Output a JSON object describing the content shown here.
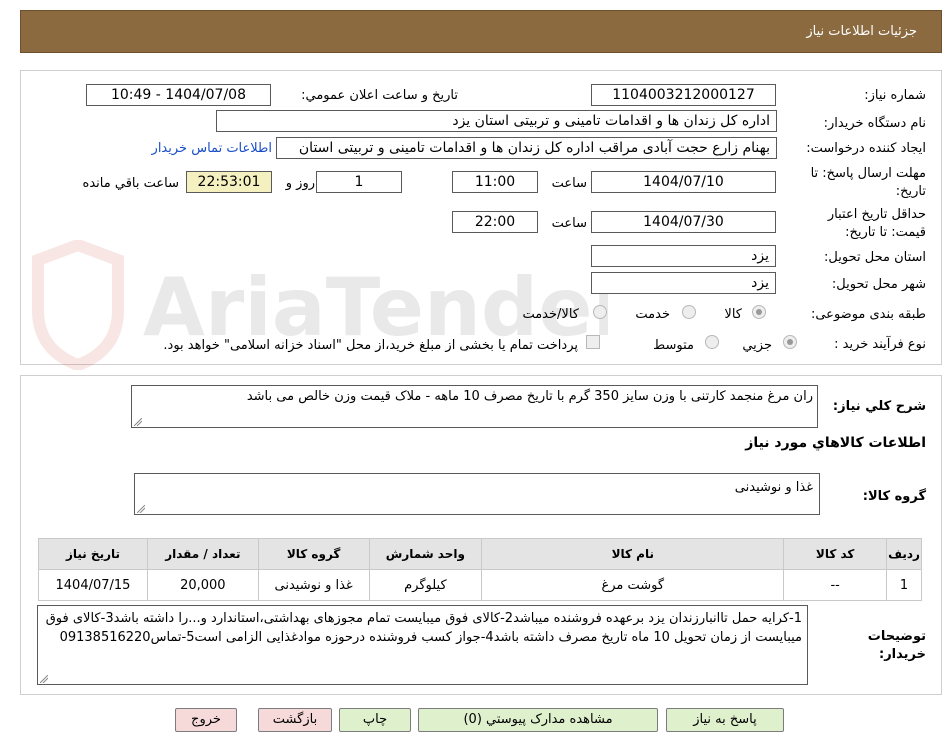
{
  "header": {
    "title": "جزئیات اطلاعات نیاز"
  },
  "labels": {
    "need_number": "شماره نیاز:",
    "announce_datetime": "تاریخ و ساعت اعلان عمومي:",
    "buyer_org": "نام دستگاه خريدار:",
    "requester": "ايجاد کننده درخواست:",
    "deadline": "مهلت ارسال پاسخ: تا تاریخ:",
    "hour": "ساعت",
    "days_and": "روز و",
    "remaining": "ساعت باقي مانده",
    "validity": "حداقل تاريخ اعتبار قيمت: تا تاريخ:",
    "hour2": "ساعت",
    "province": "استان محل تحويل:",
    "city": "شهر محل تحويل:",
    "category": "طبقه بندی موضوعی:",
    "process": "نوع فرآيند خريد :",
    "general_desc": "شرح کلي نياز:",
    "items_title": "اطلاعات کالاهاي مورد نياز",
    "goods_group": "گروه کالا:",
    "buyer_notes": "توضيحات خريدار:"
  },
  "fields": {
    "need_number": "1104003212000127",
    "announce_datetime": "1404/07/08 - 10:49",
    "buyer_org": "اداره کل زندان ها و اقدامات تامینی و تربیتی استان یزد",
    "requester": "بهنام زارع حجت آبادی مراقب اداره کل زندان ها و اقدامات تامینی و تربیتی استان",
    "contact_link": "اطلاعات تماس خريدار",
    "deadline_date": "1404/07/10",
    "deadline_time": "11:00",
    "days": "1",
    "remaining_time": "22:53:01",
    "validity_date": "1404/07/30",
    "validity_time": "22:00",
    "province": "يزد",
    "city": "يزد",
    "general_desc": "ران مرغ منجمد کارتنی با وزن سایز 350 گرم با تاریخ مصرف 10 ماهه - ملاک قیمت وزن خالص می باشد",
    "goods_group": "غذا و نوشيدنی",
    "buyer_notes": "1-کرایه حمل تاانبارزندان یزد برعهده فروشنده میباشد2-کالای فوق میبایست تمام مجوزهای بهداشتی،استاندارد و...را داشته باشد3-کالای فوق میبایست از زمان تحویل 10 ماه تاریخ مصرف داشته باشد4-جواز کسب فروشنده درحوزه موادغذایی الزامی است5-تماس09138516220"
  },
  "category_options": {
    "goods": "کالا",
    "service": "خدمت",
    "goods_service": "کالا/خدمت"
  },
  "process_options": {
    "partial": "جزيي",
    "medium": "متوسط",
    "note": "پرداخت تمام يا بخشی از مبلغ خريد،از محل \"اسناد خزانه اسلامی\" خواهد بود."
  },
  "table": {
    "headers": [
      "رديف",
      "کد کالا",
      "نام کالا",
      "واحد شمارش",
      "گروه کالا",
      "تعداد / مقدار",
      "تاريخ نياز"
    ],
    "rows": [
      [
        "1",
        "--",
        "گوشت مرغ",
        "کيلوگرم",
        "غذا و نوشيدنی",
        "20,000",
        "1404/07/15"
      ]
    ]
  },
  "buttons": {
    "reply": "پاسخ به نياز",
    "attachments": "مشاهده مدارک پيوستي (0)",
    "print": "چاپ",
    "back": "بازگشت",
    "exit": "خروج"
  },
  "watermark": {
    "text": "AriaTender.neT"
  }
}
